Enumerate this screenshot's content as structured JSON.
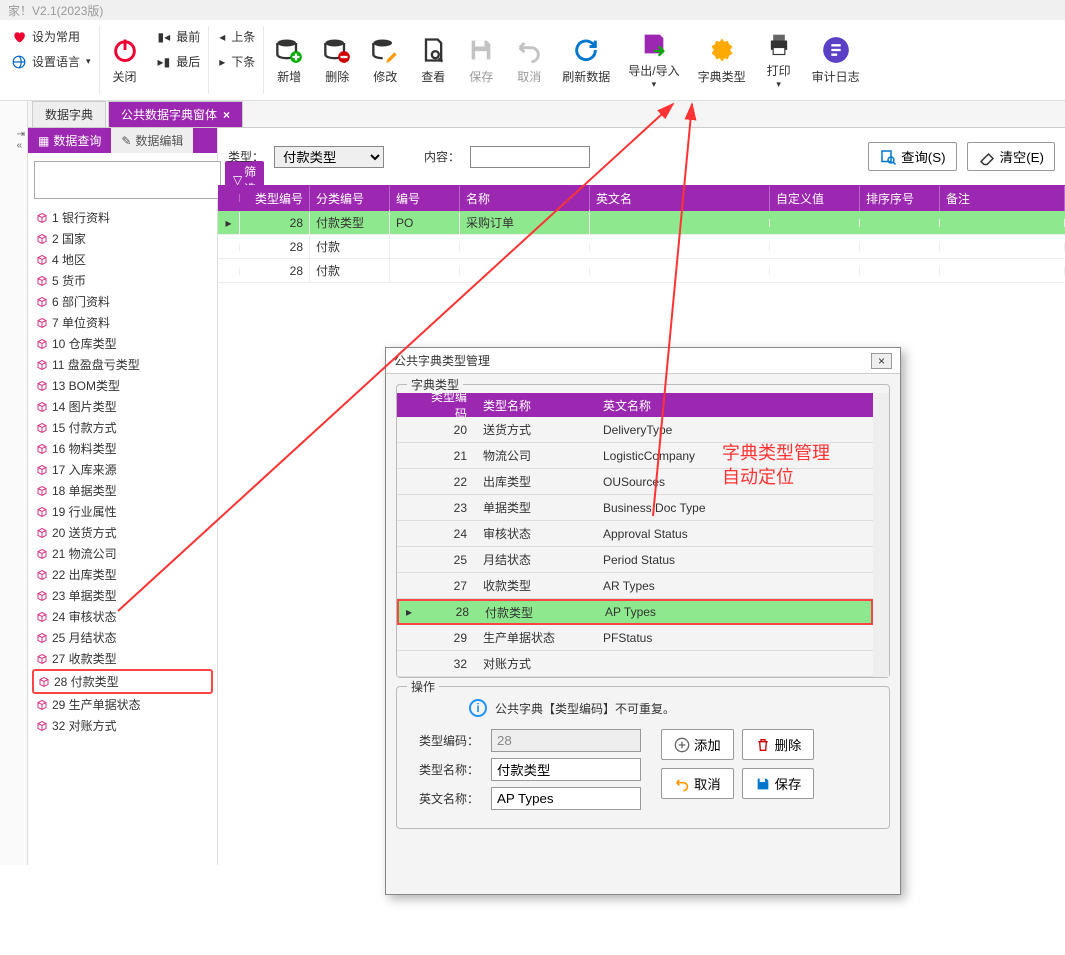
{
  "title": "家！V2.1(2023版)",
  "toolbar": {
    "setCommon": "设为常用",
    "setLang": "设置语言",
    "close": "关闭",
    "first": "最前",
    "last": "最后",
    "prev": "上条",
    "next": "下条",
    "add": "新增",
    "delete": "删除",
    "edit": "修改",
    "view": "查看",
    "save": "保存",
    "cancel": "取消",
    "refresh": "刷新数据",
    "export": "导出/导入",
    "dictType": "字典类型",
    "print": "打印",
    "auditLog": "审计日志"
  },
  "tabs": {
    "t1": "数据字典",
    "t2": "公共数据字典窗体"
  },
  "subTabs": {
    "query": "数据查询",
    "edit": "数据编辑"
  },
  "filterBtn": "筛选",
  "tree": [
    {
      "id": "1",
      "label": "1 银行资料"
    },
    {
      "id": "2",
      "label": "2 国家"
    },
    {
      "id": "4",
      "label": "4 地区"
    },
    {
      "id": "5",
      "label": "5 货币"
    },
    {
      "id": "6",
      "label": "6 部门资料"
    },
    {
      "id": "7",
      "label": "7 单位资料"
    },
    {
      "id": "10",
      "label": "10 仓库类型"
    },
    {
      "id": "11",
      "label": "11 盘盈盘亏类型"
    },
    {
      "id": "13",
      "label": "13 BOM类型"
    },
    {
      "id": "14",
      "label": "14 图片类型"
    },
    {
      "id": "15",
      "label": "15 付款方式"
    },
    {
      "id": "16",
      "label": "16 物料类型"
    },
    {
      "id": "17",
      "label": "17 入库来源"
    },
    {
      "id": "18",
      "label": "18 单据类型"
    },
    {
      "id": "19",
      "label": "19 行业属性"
    },
    {
      "id": "20",
      "label": "20 送货方式"
    },
    {
      "id": "21",
      "label": "21 物流公司"
    },
    {
      "id": "22",
      "label": "22 出库类型"
    },
    {
      "id": "23",
      "label": "23 单据类型"
    },
    {
      "id": "24",
      "label": "24 审核状态"
    },
    {
      "id": "25",
      "label": "25 月结状态"
    },
    {
      "id": "27",
      "label": "27 收款类型"
    },
    {
      "id": "28",
      "label": "28 付款类型",
      "hl": true
    },
    {
      "id": "29",
      "label": "29 生产单据状态"
    },
    {
      "id": "32",
      "label": "32 对账方式"
    }
  ],
  "query": {
    "typeLabel": "类型：",
    "typeValue": "付款类型",
    "contentLabel": "内容：",
    "searchBtn": "查询(S)",
    "clearBtn": "清空(E)"
  },
  "gridHeaders": {
    "typeCode": "类型编号",
    "catCode": "分类编号",
    "code": "编号",
    "name": "名称",
    "enName": "英文名",
    "custom": "自定义值",
    "sort": "排序序号",
    "note": "备注"
  },
  "gridRows": [
    {
      "type": "28",
      "cat": "付款类型",
      "code": "PO",
      "name": "采购订单",
      "hl": true
    },
    {
      "type": "28",
      "cat": "付款"
    },
    {
      "type": "28",
      "cat": "付款"
    }
  ],
  "modal": {
    "title": "公共字典类型管理",
    "groupDict": "字典类型",
    "hdr": {
      "code": "类型编码",
      "name": "类型名称",
      "en": "英文名称"
    },
    "rows": [
      {
        "code": "20",
        "name": "送货方式",
        "en": "DeliveryType"
      },
      {
        "code": "21",
        "name": "物流公司",
        "en": "LogisticCompany"
      },
      {
        "code": "22",
        "name": "出库类型",
        "en": "OUSources"
      },
      {
        "code": "23",
        "name": "单据类型",
        "en": "Business Doc Type"
      },
      {
        "code": "24",
        "name": "审核状态",
        "en": "Approval Status"
      },
      {
        "code": "25",
        "name": "月结状态",
        "en": "Period Status"
      },
      {
        "code": "27",
        "name": "收款类型",
        "en": "AR Types"
      },
      {
        "code": "28",
        "name": "付款类型",
        "en": "AP Types",
        "hl": true
      },
      {
        "code": "29",
        "name": "生产单据状态",
        "en": "PFStatus"
      },
      {
        "code": "32",
        "name": "对账方式",
        "en": ""
      }
    ],
    "groupOp": "操作",
    "info": "公共字典【类型编码】不可重复。",
    "form": {
      "codeLabel": "类型编码：",
      "codeVal": "28",
      "nameLabel": "类型名称：",
      "nameVal": "付款类型",
      "enLabel": "英文名称：",
      "enVal": "AP Types"
    },
    "btns": {
      "add": "添加",
      "del": "删除",
      "cancel": "取消",
      "save": "保存"
    }
  },
  "annotation": {
    "line1": "字典类型管理",
    "line2": "自动定位"
  }
}
